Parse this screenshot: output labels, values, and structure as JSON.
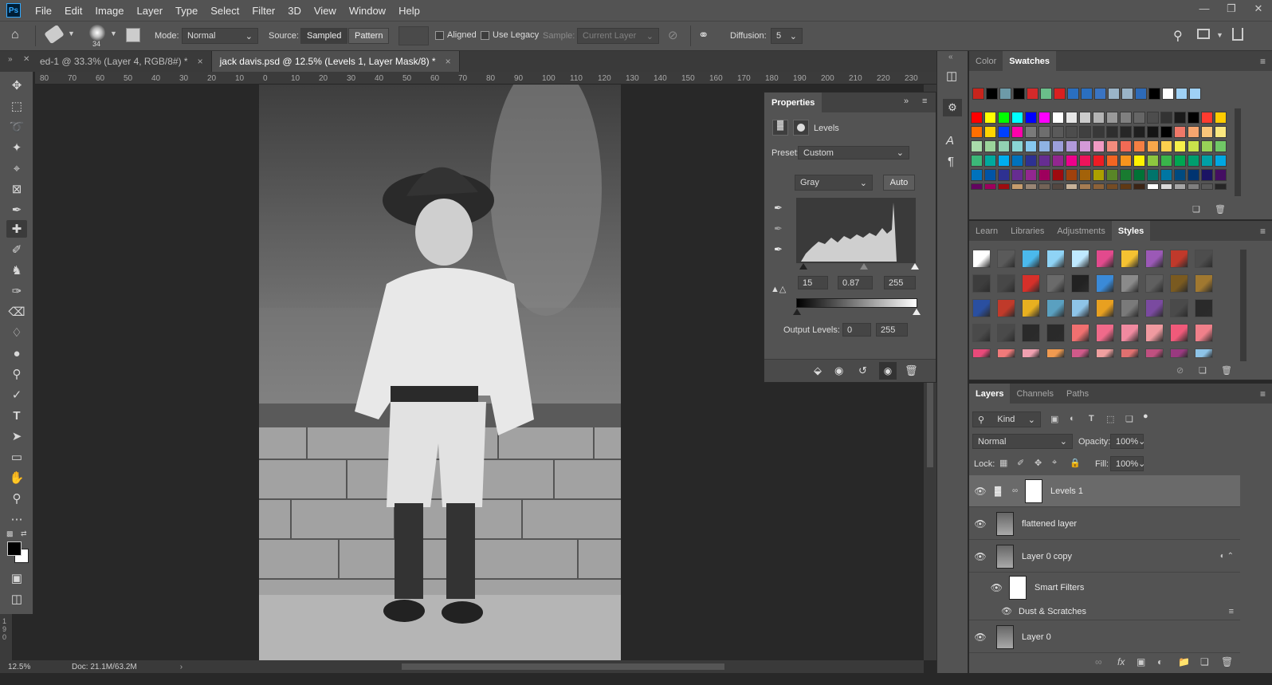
{
  "menubar": {
    "logo": "Ps",
    "items": [
      "File",
      "Edit",
      "Image",
      "Layer",
      "Type",
      "Select",
      "Filter",
      "3D",
      "View",
      "Window",
      "Help"
    ]
  },
  "options": {
    "brush_size": "34",
    "mode_label": "Mode:",
    "mode_value": "Normal",
    "source_label": "Source:",
    "sampled": "Sampled",
    "pattern": "Pattern",
    "aligned": "Aligned",
    "use_legacy": "Use Legacy",
    "sample_label": "Sample:",
    "sample_value": "Current Layer",
    "diffusion_label": "Diffusion:",
    "diffusion_value": "5"
  },
  "tabs": [
    {
      "label": "ed-1 @ 33.3% (Layer 4, RGB/8#) *",
      "close": "×"
    },
    {
      "label": "jack davis.psd @ 12.5% (Levels 1, Layer Mask/8) *",
      "close": "×"
    }
  ],
  "ruler": [
    "80",
    "70",
    "60",
    "50",
    "40",
    "30",
    "20",
    "10",
    "0",
    "10",
    "20",
    "30",
    "40",
    "50",
    "60",
    "70",
    "80",
    "90",
    "100",
    "110",
    "120",
    "130",
    "140",
    "150",
    "160",
    "170",
    "180",
    "190",
    "200",
    "210",
    "220",
    "230"
  ],
  "vruler": [
    "1",
    "9",
    "0"
  ],
  "status": {
    "zoom": "12.5%",
    "doc": "Doc: 21.1M/63.2M"
  },
  "properties": {
    "title": "Properties",
    "type": "Levels",
    "preset_label": "Preset:",
    "preset_value": "Custom",
    "channel": "Gray",
    "auto": "Auto",
    "input_black": "15",
    "input_gamma": "0.87",
    "input_white": "255",
    "output_label": "Output Levels:",
    "output_black": "0",
    "output_white": "255"
  },
  "swatches_panel": {
    "tabs": [
      "Color",
      "Swatches"
    ],
    "recent": [
      "#c8241c",
      "#000000",
      "#6d9aa8",
      "#000000",
      "#d42a2a",
      "#6abf8a",
      "#d82020",
      "#2a6fc0",
      "#2a6fc0",
      "#3a74c2",
      "#9ab4c8",
      "#9ab4c8",
      "#2d6ab8",
      "#000000",
      "#ffffff",
      "#9fd1f5",
      "#9fd1f5"
    ],
    "rows": [
      [
        "#ff0000",
        "#ffff00",
        "#00ff00",
        "#00ffff",
        "#0000ff",
        "#ff00ff",
        "#ffffff",
        "#e6e6e6",
        "#cccccc",
        "#b3b3b3",
        "#999999",
        "#808080",
        "#666666",
        "#4d4d4d",
        "#333333",
        "#1a1a1a",
        "#000000",
        "#ff3b30",
        "#ffcc00"
      ],
      [
        "#ff6f00",
        "#ffd500",
        "#0040ff",
        "#ff00aa",
        "#7a7a7a",
        "#6e6e6e",
        "#5a5a5a",
        "#4d4d4d",
        "#404040",
        "#383838",
        "#2e2e2e",
        "#262626",
        "#1f1f1f",
        "#141414",
        "#000000",
        "#f07868",
        "#f6a56f",
        "#f9c57a",
        "#fbe77f"
      ],
      [
        "#a9dcaa",
        "#9bd49b",
        "#92d1b3",
        "#8ad5d5",
        "#86c8ef",
        "#8fb3e3",
        "#9c9fdb",
        "#b19ada",
        "#d39ad8",
        "#f09ac3",
        "#f28b7d",
        "#f26a55",
        "#f47f43",
        "#f8a84a",
        "#fbd04e",
        "#f6ef4a",
        "#c9e24b",
        "#98d257",
        "#70c766"
      ],
      [
        "#3cb878",
        "#00a99d",
        "#00aeef",
        "#0072bc",
        "#2e3192",
        "#662d91",
        "#92278f",
        "#ec008c",
        "#ed145b",
        "#ed1c24",
        "#f26522",
        "#f7941d",
        "#fff200",
        "#8dc63f",
        "#39b54a",
        "#00a651",
        "#009e6e",
        "#00a0a6",
        "#00a7e1"
      ],
      [
        "#0072bc",
        "#0054a6",
        "#2e3192",
        "#662d91",
        "#92278f",
        "#9e005d",
        "#9e0b0f",
        "#a0410d",
        "#a36209",
        "#aba000",
        "#598527",
        "#197b30",
        "#007236",
        "#00746b",
        "#0076a3",
        "#004a80",
        "#003471",
        "#1b1464",
        "#440e62"
      ],
      [
        "#630460",
        "#9e005d",
        "#9e0b0f",
        "#c69c6d",
        "#998675",
        "#736357",
        "#534741",
        "#c7b299",
        "#a67c52",
        "#8c6239",
        "#754c24",
        "#603913",
        "#3c2415",
        "#ffffff",
        "#d9d9d9",
        "#a6a6a6",
        "#7f7f7f",
        "#595959",
        "#262626"
      ]
    ]
  },
  "styles_panel": {
    "tabs": [
      "Learn",
      "Libraries",
      "Adjustments",
      "Styles"
    ],
    "rows": [
      [
        "#ffffff",
        "#5a5a5a",
        "#4bb9ec",
        "#8fd3f5",
        "#bfe9ff",
        "#e24a8d",
        "#f5c232",
        "#9b59b6",
        "#c0392b",
        "#4d4d4d"
      ],
      [
        "#3d3d3d",
        "#474747",
        "#d6302a",
        "#6a6a6a",
        "#222222",
        "#3a8ad8",
        "#8a8a8a",
        "#5f5f5f",
        "#7a5a20",
        "#a07830"
      ],
      [
        "#2a4fa0",
        "#c03a2a",
        "#e8b020",
        "#5aa0c0",
        "#8ec4e8",
        "#e8a020",
        "#7a7a7a",
        "#7a4aa0",
        "#4a4a4a",
        "#2a2a2a"
      ],
      [
        "#4a4a4a",
        "#4a4a4a",
        "#2a2a2a",
        "#2a2a2a",
        "#f07070",
        "#f06a8a",
        "#f08aa0",
        "#f09aa0",
        "#f05a7a",
        "#f0808a"
      ],
      [
        "#e84a7a",
        "#f07a7a",
        "#f0a0b0",
        "#f09a50",
        "#d05a8a",
        "#f0a0a0",
        "#e07070",
        "#c05080",
        "#9a3a80",
        "#8ec4e8"
      ]
    ]
  },
  "layers_panel": {
    "tabs": [
      "Layers",
      "Channels",
      "Paths"
    ],
    "kind": "Kind",
    "blend": "Normal",
    "opacity_label": "Opacity:",
    "opacity": "100%",
    "lock_label": "Lock:",
    "fill_label": "Fill:",
    "fill": "100%",
    "layers": [
      {
        "name": "Levels 1"
      },
      {
        "name": "flattened layer"
      },
      {
        "name": "Layer 0 copy"
      },
      {
        "name": "Smart Filters"
      },
      {
        "name": "Dust & Scratches"
      },
      {
        "name": "Layer 0"
      }
    ]
  }
}
